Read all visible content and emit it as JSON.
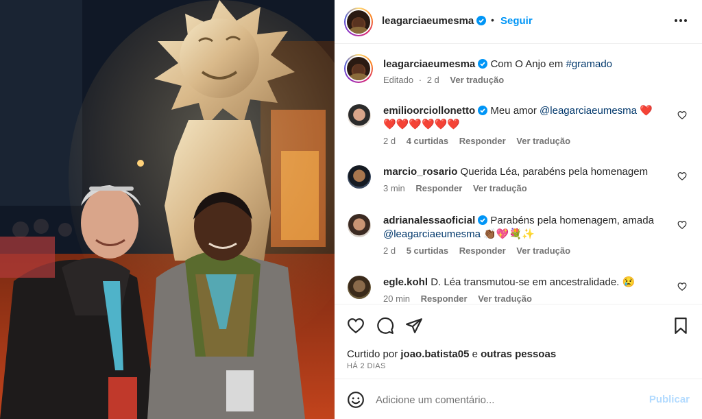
{
  "post": {
    "author": "leagarciaeumesma",
    "separator": "•",
    "follow_label": "Seguir",
    "more_icon": "more-horizontal-icon"
  },
  "caption": {
    "author": "leagarciaeumesma",
    "text": "Com O Anjo em ",
    "hashtag": "#gramado",
    "edited": "Editado",
    "separator": "·",
    "time": "2 d",
    "translate": "Ver tradução"
  },
  "comments": [
    {
      "author": "emilioorciollonetto",
      "verified": true,
      "text_before": " Meu amor ",
      "mention": "@leagarciaeumesma",
      "text_after": " ❤️❤️❤️❤️❤️❤️❤️",
      "time": "2 d",
      "likes": "4 curtidas",
      "reply": "Responder",
      "translate": "Ver tradução"
    },
    {
      "author": "marcio_rosario",
      "verified": false,
      "text_before": " Querida Léa, parabéns pela homenagem",
      "mention": "",
      "text_after": "",
      "time": "3 min",
      "likes": "",
      "reply": "Responder",
      "translate": "Ver tradução"
    },
    {
      "author": "adrianalessaoficial",
      "verified": true,
      "text_before": " Parabéns pela homenagem, amada ",
      "mention": "@leagarciaeumesma",
      "text_after": " 👏🏾💖💐✨",
      "time": "2 d",
      "likes": "5 curtidas",
      "reply": "Responder",
      "translate": "Ver tradução"
    },
    {
      "author": "egle.kohl",
      "verified": false,
      "text_before": " D. Léa transmutou-se em ancestralidade. 😢",
      "mention": "",
      "text_after": "",
      "time": "20 min",
      "likes": "",
      "reply": "Responder",
      "translate": "Ver tradução"
    }
  ],
  "actions": {
    "like_icon": "heart-icon",
    "comment_icon": "comment-icon",
    "share_icon": "send-icon",
    "save_icon": "bookmark-icon",
    "liked_by_prefix": "Curtido por ",
    "liked_by_user": "joao.batista05",
    "liked_by_middle": " e ",
    "liked_by_others": "outras pessoas",
    "date": "HÁ 2 DIAS"
  },
  "add_comment": {
    "emoji_icon": "smiley-icon",
    "placeholder": "Adicione um comentário...",
    "publish_label": "Publicar"
  },
  "colors": {
    "accent": "#0095f6",
    "verified": "#0095f6",
    "link": "#00376b",
    "muted": "#737373",
    "publish_disabled": "#b3dbff"
  }
}
